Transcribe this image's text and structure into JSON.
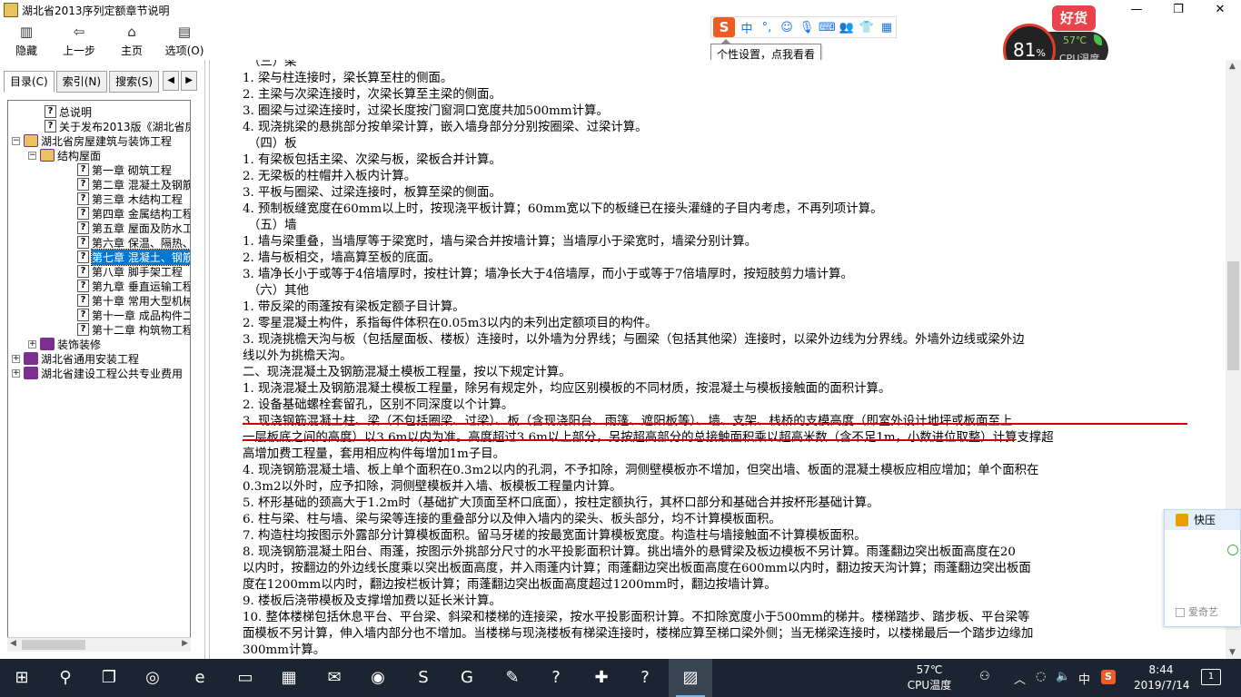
{
  "window": {
    "title": "湖北省2013序列定额章节说明"
  },
  "toolbar": [
    {
      "label": "隐藏",
      "icon": "hide-icon",
      "glyph": "▥"
    },
    {
      "label": "上一步",
      "icon": "back-arrow-icon",
      "glyph": "⇦"
    },
    {
      "label": "主页",
      "icon": "home-icon",
      "glyph": "⌂"
    },
    {
      "label": "选项(O)",
      "icon": "options-icon",
      "glyph": "▤"
    }
  ],
  "ime": {
    "tooltip": "个性设置，点我看看",
    "lang": "中"
  },
  "cpu": {
    "usage": "81",
    "usage_unit": "%",
    "temp": "57℃",
    "label": "CPU温度",
    "badge": "好货"
  },
  "tabs": [
    {
      "label": "目录(C)",
      "active": true
    },
    {
      "label": "索引(N)",
      "active": false
    },
    {
      "label": "搜索(S)",
      "active": false
    }
  ],
  "tree": [
    {
      "type": "page",
      "level": 2,
      "label": "总说明"
    },
    {
      "type": "page",
      "level": 2,
      "label": "关于发布2013版《湖北省房屋"
    },
    {
      "type": "book-open",
      "level": 1,
      "expander": "−",
      "label": "湖北省房屋建筑与装饰工程"
    },
    {
      "type": "book-open",
      "level": 2,
      "expander": "−",
      "label": "结构屋面"
    },
    {
      "type": "page",
      "level": 4,
      "label": "第一章  砌筑工程"
    },
    {
      "type": "page",
      "level": 4,
      "label": "第二章  混凝土及钢筋"
    },
    {
      "type": "page",
      "level": 4,
      "label": "第三章  木结构工程"
    },
    {
      "type": "page",
      "level": 4,
      "label": "第四章  金属结构工程"
    },
    {
      "type": "page",
      "level": 4,
      "label": "第五章  屋面及防水工程"
    },
    {
      "type": "page",
      "level": 4,
      "label": "第六章  保温、隔热、防"
    },
    {
      "type": "page",
      "level": 4,
      "label": "第七章  混凝土、钢筋",
      "selected": true
    },
    {
      "type": "page",
      "level": 4,
      "label": "第八章  脚手架工程"
    },
    {
      "type": "page",
      "level": 4,
      "label": "第九章  垂直运输工程"
    },
    {
      "type": "page",
      "level": 4,
      "label": "第十章  常用大型机械安"
    },
    {
      "type": "page",
      "level": 4,
      "label": "第十一章  成品构件二次"
    },
    {
      "type": "page",
      "level": 4,
      "label": "第十二章  构筑物工程"
    },
    {
      "type": "book",
      "level": 2,
      "expander": "+",
      "label": "装饰装修"
    },
    {
      "type": "book",
      "level": 1,
      "expander": "+",
      "label": "湖北省通用安装工程"
    },
    {
      "type": "book",
      "level": 1,
      "expander": "+",
      "label": "湖北省建设工程公共专业费用"
    }
  ],
  "content_lines": [
    {
      "text": "（三）梁",
      "kind": "sub"
    },
    {
      "text": "1. 梁与柱连接时，梁长算至柱的侧面。"
    },
    {
      "text": "2. 主梁与次梁连接时，次梁长算至主梁的侧面。"
    },
    {
      "text": "3. 圈梁与过梁连接时，过梁长度按门窗洞口宽度共加500mm计算。"
    },
    {
      "text": "4. 现浇挑梁的悬挑部分按单梁计算，嵌入墙身部分分别按圈梁、过梁计算。"
    },
    {
      "text": "（四）板",
      "kind": "sub"
    },
    {
      "text": "1. 有梁板包括主梁、次梁与板，梁板合并计算。"
    },
    {
      "text": "2. 无梁板的柱帽并入板内计算。"
    },
    {
      "text": "3. 平板与圈梁、过梁连接时，板算至梁的侧面。"
    },
    {
      "text": "4. 预制板缝宽度在60mm以上时，按现浇平板计算；60mm宽以下的板缝已在接头灌缝的子目内考虑，不再列项计算。"
    },
    {
      "text": "（五）墙",
      "kind": "sub"
    },
    {
      "text": "1. 墙与梁重叠，当墙厚等于梁宽时，墙与梁合并按墙计算；当墙厚小于梁宽时，墙梁分别计算。"
    },
    {
      "text": "2. 墙与板相交，墙高算至板的底面。"
    },
    {
      "text": "3. 墙净长小于或等于4倍墙厚时，按柱计算；墙净长大于4倍墙厚，而小于或等于7倍墙厚时，按短肢剪力墙计算。"
    },
    {
      "text": "（六）其他",
      "kind": "sub"
    },
    {
      "text": "1. 带反梁的雨蓬按有梁板定额子目计算。"
    },
    {
      "text": "2. 零星混凝土构件，系指每件体积在0.05m3以内的未列出定额项目的构件。"
    },
    {
      "text": "3. 现浇挑檐天沟与板（包括屋面板、楼板）连接时，以外墙为分界线；与圈梁（包括其他梁）连接时，以梁外边线为分界线。外墙外边线或梁外边"
    },
    {
      "text": "线以外为挑檐天沟。",
      "kind": "cont"
    },
    {
      "text": "二、现浇混凝土及钢筋混凝土模板工程量，按以下规定计算。"
    },
    {
      "text": "1. 现浇混凝土及钢筋混凝土模板工程量，除另有规定外，均应区别模板的不同材质，按混凝土与模板接触面的面积计算。"
    },
    {
      "text": "2. 设备基础螺栓套留孔，区别不同深度以个计算。"
    },
    {
      "text": "3. 现浇钢筋混凝土柱、梁（不包括圈梁、过梁）、板（含现浇阳台、雨篷、遮阳板等）、墙、支架、栈桥的支模高度（即室外设计地坪或板面至上"
    },
    {
      "text": "一层板底之间的高度）以3.6m以内为准。高度超过3.6m以上部分，另按超高部分的总接触面积乘以超高米数（含不足1m，小数进位取整）计算支撑超",
      "kind": "cont"
    },
    {
      "text": "高增加费工程量，套用相应构件每增加1m子目。",
      "kind": "cont"
    },
    {
      "text": "4. 现浇钢筋混凝土墙、板上单个面积在0.3m2以内的孔洞，不予扣除，洞侧壁模板亦不增加，但突出墙、板面的混凝土模板应相应增加；单个面积在"
    },
    {
      "text": "0.3m2以外时，应予扣除，洞侧壁模板并入墙、板模板工程量内计算。",
      "kind": "cont"
    },
    {
      "text": "5. 杯形基础的颈高大于1.2m时（基础扩大顶面至杯口底面），按柱定额执行，其杯口部分和基础合并按杯形基础计算。"
    },
    {
      "text": "6. 柱与梁、柱与墙、梁与梁等连接的重叠部分以及伸入墙内的梁头、板头部分，均不计算模板面积。"
    },
    {
      "text": "7. 构造柱均按图示外露部分计算模板面积。留马牙槎的按最宽面计算模板宽度。构造柱与墙接触面不计算模板面积。"
    },
    {
      "text": "8. 现浇钢筋混凝土阳台、雨蓬，按图示外挑部分尺寸的水平投影面积计算。挑出墙外的悬臂梁及板边模板不另计算。雨蓬翻边突出板面高度在20"
    },
    {
      "text": "以内时，按翻边的外边线长度乘以突出板面高度，并入雨蓬内计算；雨蓬翻边突出板面高度在600mm以内时，翻边按天沟计算；雨蓬翻边突出板面",
      "kind": "cont"
    },
    {
      "text": "度在1200mm以内时，翻边按栏板计算；雨蓬翻边突出板面高度超过1200mm时，翻边按墙计算。",
      "kind": "cont"
    },
    {
      "text": "9. 楼板后浇带模板及支撑增加费以延长米计算。"
    },
    {
      "text": "10. 整体楼梯包括休息平台、平台梁、斜梁和楼梯的连接梁，按水平投影面积计算。不扣除宽度小于500mm的梯井。楼梯踏步、踏步板、平台梁等"
    },
    {
      "text": "面模板不另计算，伸入墙内部分也不增加。当楼梯与现浇楼板有梯梁连接时，楼梯应算至梯口梁外侧；当无梯梁连接时，以楼梯最后一个踏步边缘加",
      "kind": "cont"
    },
    {
      "text": "300mm计算。",
      "kind": "cont"
    }
  ],
  "float_panel": {
    "title": "快压",
    "option": "爱奇艺"
  },
  "taskbar": {
    "apps": [
      {
        "icon": "windows-start-icon",
        "glyph": "⊞"
      },
      {
        "icon": "search-icon",
        "glyph": "⚲"
      },
      {
        "icon": "task-view-icon",
        "glyph": "❐"
      },
      {
        "icon": "cortana-icon",
        "glyph": "◎"
      },
      {
        "icon": "edge-browser-icon",
        "glyph": "e"
      },
      {
        "icon": "file-explorer-icon",
        "glyph": "▭"
      },
      {
        "icon": "store-icon",
        "glyph": "▦"
      },
      {
        "icon": "mail-icon",
        "glyph": "✉"
      },
      {
        "icon": "green-browser-icon",
        "glyph": "◉"
      },
      {
        "icon": "sogou-browser-icon",
        "glyph": "S"
      },
      {
        "icon": "g-app-icon",
        "glyph": "G"
      },
      {
        "icon": "notepad-icon",
        "glyph": "✎"
      },
      {
        "icon": "help-file-icon",
        "glyph": "?"
      },
      {
        "icon": "tool-app-icon",
        "glyph": "✚"
      },
      {
        "icon": "help-file-icon-2",
        "glyph": "?"
      },
      {
        "icon": "chm-viewer-icon",
        "glyph": "▨",
        "active": true
      }
    ],
    "temp": "57℃",
    "temp_label": "CPU温度",
    "lang": "中",
    "time": "8:44",
    "date": "2019/7/14",
    "notifications": "1"
  },
  "colors": {
    "accent": "#0078d7",
    "highlight_line": "#d00000",
    "taskbar": "#1b2431"
  }
}
